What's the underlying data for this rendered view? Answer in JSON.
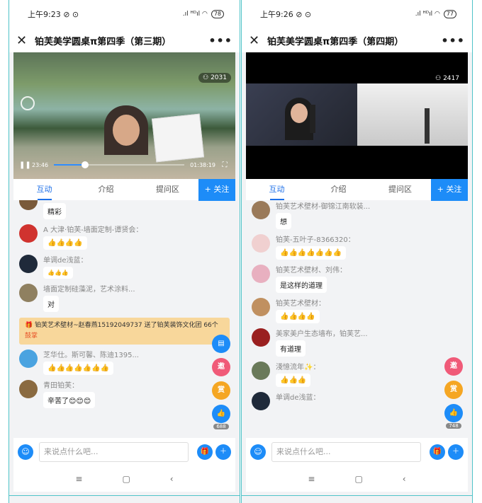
{
  "screens": [
    {
      "status_time": "上午9:23",
      "status_icons": "⊘ ⊙",
      "signal": ".ıl ᴴᴰıl ◠",
      "battery": "78",
      "title": "铂芙美学圆桌π第四季（第三期）",
      "close_icon": "✕",
      "more_icon": "•••",
      "viewers": "⚇ 2031",
      "player": {
        "elapsed": "23:46",
        "total": "01:38:19",
        "progress_fraction": 0.24
      },
      "tabs": [
        "互动",
        "介绍",
        "提问区"
      ],
      "follow": "+ 关注",
      "messages": [
        {
          "name": "",
          "text": "精彩",
          "avatar_color": "#7a5a3a"
        },
        {
          "name": "A 大津·铂芙-墙面定制-谭贤会：",
          "text": "👍👍👍👍",
          "avatar_color": "#d0332f"
        },
        {
          "name": "单调de浅蓝：",
          "text": "👍👍👍",
          "avatar_color": "#1f2a3a"
        },
        {
          "name": "墙面定制硅藻泥，艺术涂料...",
          "text": "对",
          "avatar_color": "#8f8060"
        },
        {
          "name": "芝华仕。斯可馨、陈迪1395...",
          "text": "👍👍👍👍👍👍👍",
          "avatar_color": "#4aa3e0"
        },
        {
          "name": "青田铂芙：",
          "text": "辛苦了😊😊😊",
          "avatar_color": "#8a6a40"
        }
      ],
      "gift": {
        "text": "🎁 铂芙艺术壁材~赵春燕15192049737 送了铂芙装饰文化团 66个 ",
        "highlight": "鼓掌"
      },
      "side_buttons": {
        "invite": "邀",
        "reward": "赏",
        "like": "👍",
        "like_count": "688",
        "note": "▤"
      },
      "input_placeholder": "来说点什么吧...",
      "nav": [
        "≡",
        "▢",
        "‹"
      ]
    },
    {
      "status_time": "上午9:26",
      "status_icons": "⊘ ⊙",
      "signal": ".ıl ᴴᴰıl ◠",
      "battery": "77",
      "title": "铂芙美学圆桌π第四季（第四期）",
      "close_icon": "✕",
      "more_icon": "•••",
      "viewers": "⚇ 2417",
      "tabs": [
        "互动",
        "介绍",
        "提问区"
      ],
      "follow": "+ 关注",
      "messages": [
        {
          "name": "铂芙艺术壁材-御锦江南软装...",
          "text": "想",
          "avatar_color": "#9a7a5a"
        },
        {
          "name": "铂芙-五叶子-8366320：",
          "text": "👍👍👍👍👍👍👍",
          "avatar_color": "#f0d0d0"
        },
        {
          "name": "铂芙艺术壁材、刘伟：",
          "text": "是这样的道理",
          "avatar_color": "#e8b0c0"
        },
        {
          "name": "铂芙艺术壁材：",
          "text": "👍👍👍👍",
          "avatar_color": "#c09060"
        },
        {
          "name": "美家美户生态墙布，铂芙艺...",
          "text": "有道理",
          "avatar_color": "#9a2020"
        },
        {
          "name": "淺憶流年✨：",
          "text": "👍👍👍",
          "avatar_color": "#6a7a5a"
        },
        {
          "name": "单调de浅蓝：",
          "text": "",
          "avatar_color": "#1f2a3a"
        }
      ],
      "side_buttons": {
        "invite": "邀",
        "reward": "赏",
        "like": "👍",
        "like_count": "748"
      },
      "input_placeholder": "来说点什么吧...",
      "nav": [
        "≡",
        "▢",
        "‹"
      ]
    }
  ]
}
